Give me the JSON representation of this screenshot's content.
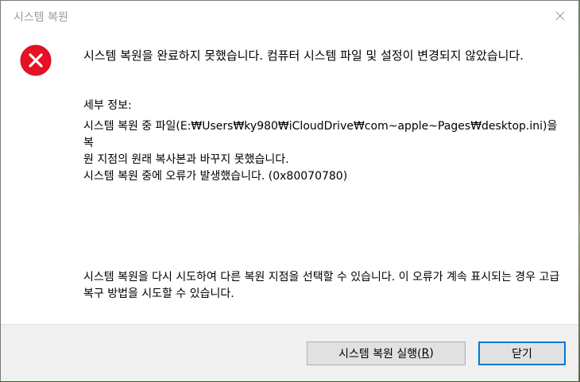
{
  "window": {
    "title": "시스템 복원"
  },
  "icons": {
    "error": "error-icon",
    "close": "close-icon"
  },
  "colors": {
    "error_red": "#e81123",
    "default_button_border": "#0078d7"
  },
  "message": {
    "main": "시스템 복원을 완료하지 못했습니다. 컴퓨터 시스템 파일 및 설정이 변경되지 않았습니다.",
    "details_label": "세부 정보:",
    "details_line1": "시스템 복원 중 파일(E:₩Users₩ky980₩iCloudDrive₩com~apple~Pages₩desktop.ini)을 복",
    "details_line2": "원 지점의 원래 복사본과 바꾸지 못했습니다.",
    "details_line3": "시스템 복원 중에 오류가 발생했습니다. (0x80070780)",
    "advice": "시스템 복원을 다시 시도하여 다른 복원 지점을 선택할 수 있습니다. 이 오류가 계속 표시되는 경우 고급 복구 방법을 시도할 수 있습니다."
  },
  "buttons": {
    "run_restore_label": "시스템 복원 실행(",
    "run_restore_accel": "R",
    "run_restore_suffix": ")",
    "close_label": "닫기"
  }
}
